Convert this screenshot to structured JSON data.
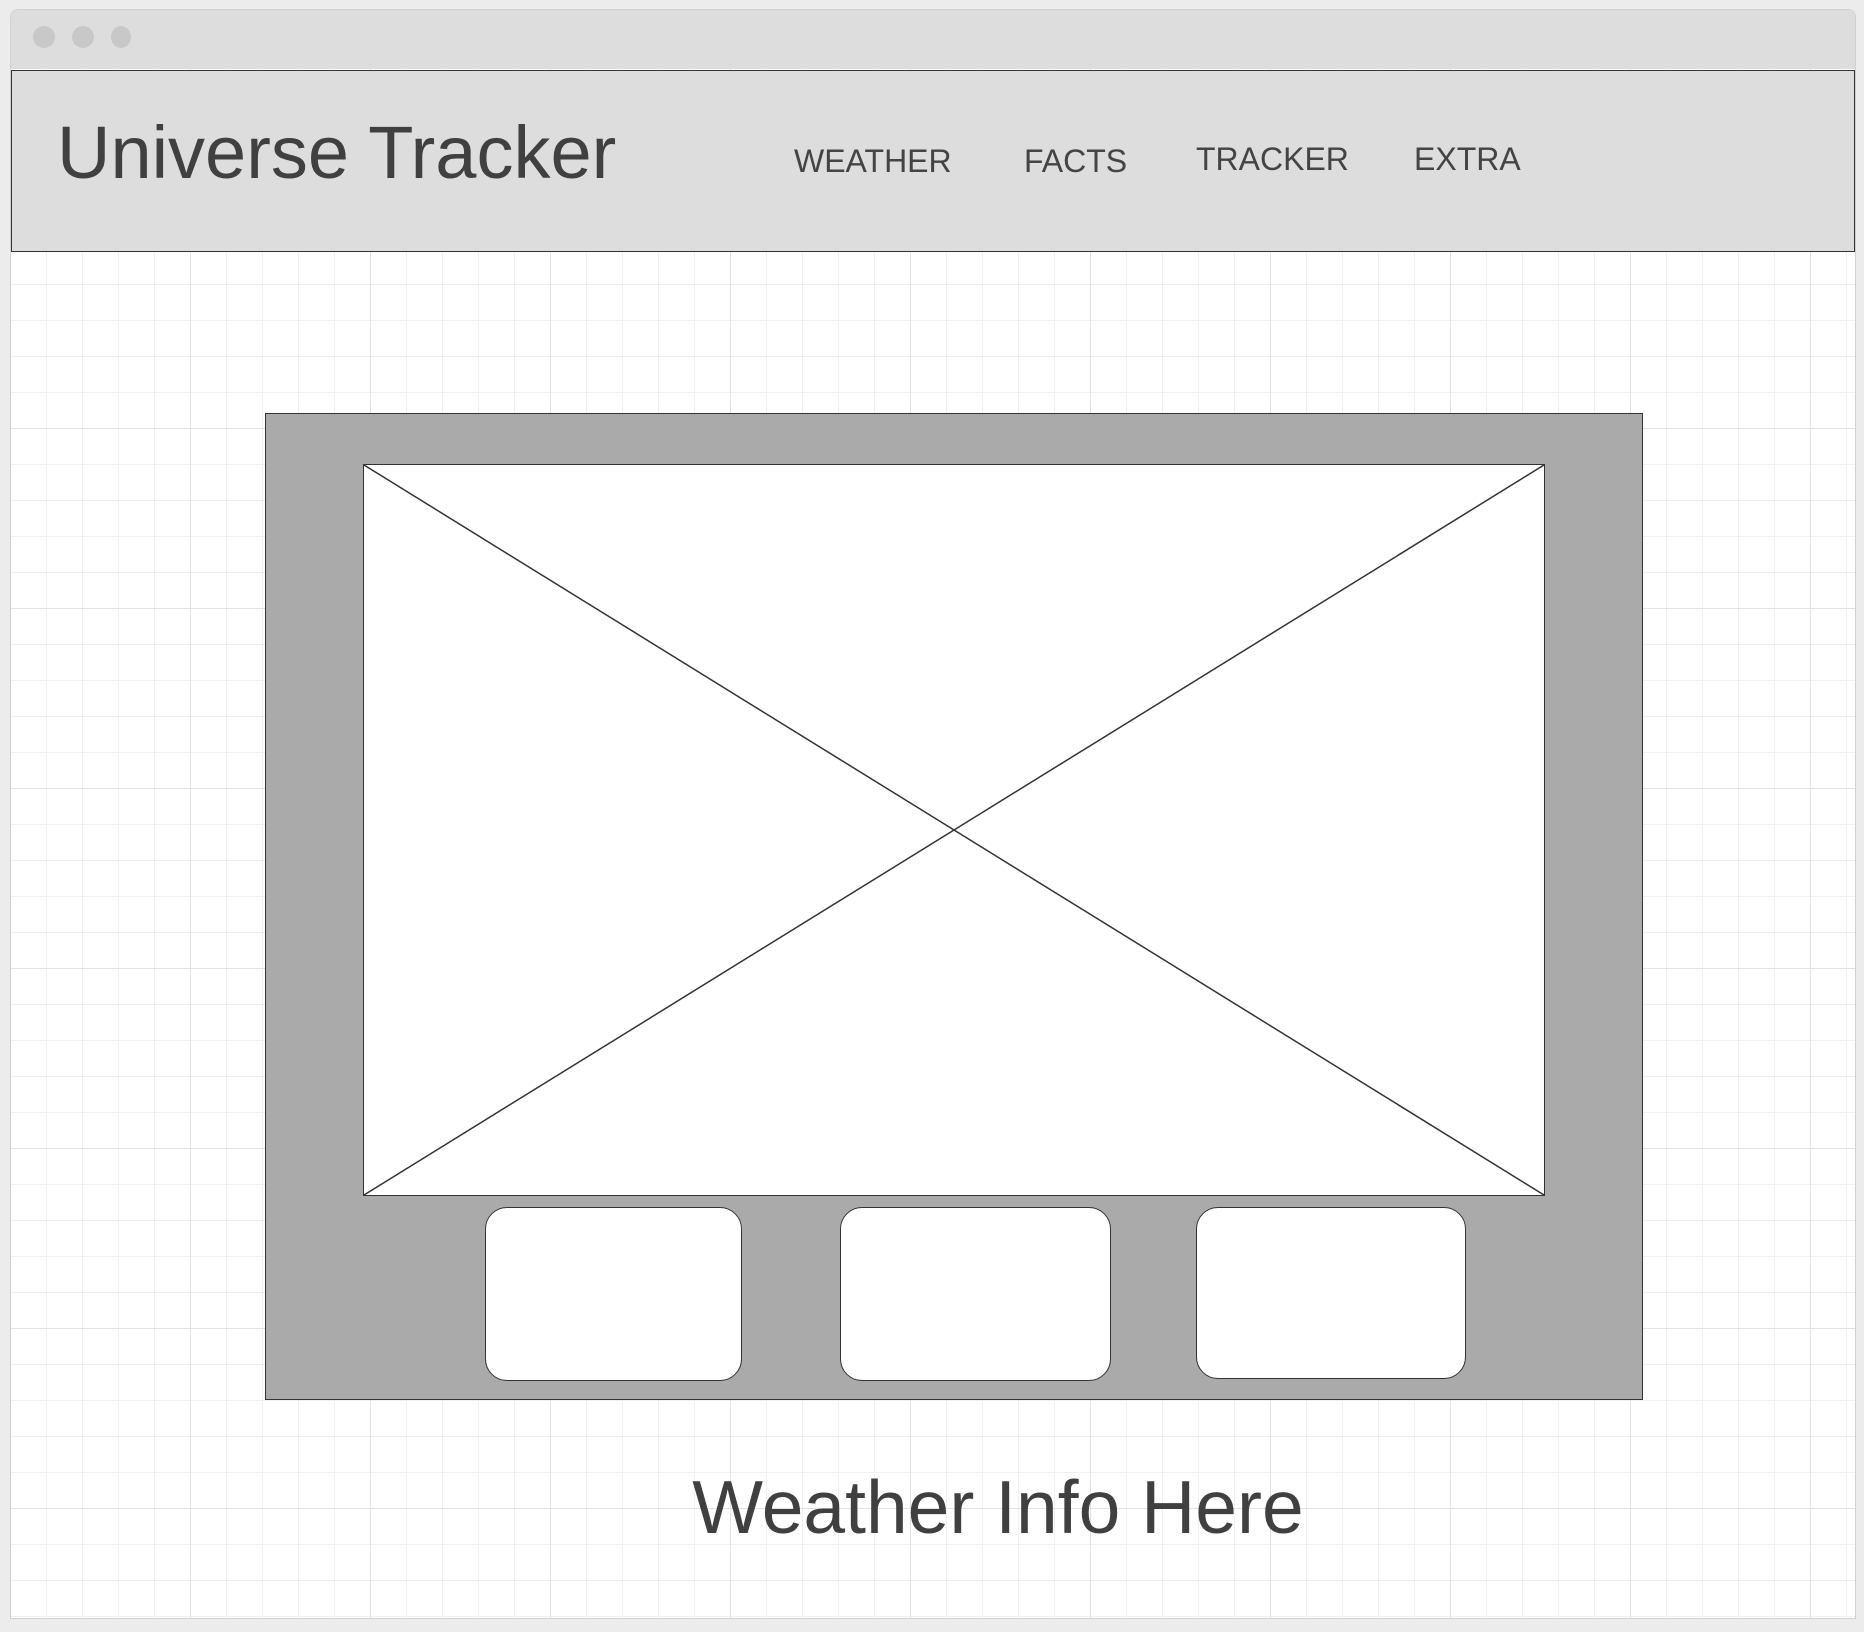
{
  "window": {
    "controls": [
      "close-icon",
      "minimize-icon",
      "maximize-icon"
    ]
  },
  "header": {
    "title": "Universe Tracker",
    "nav": [
      {
        "label": "WEATHER"
      },
      {
        "label": "FACTS"
      },
      {
        "label": "TRACKER"
      },
      {
        "label": "EXTRA"
      }
    ]
  },
  "main": {
    "image_icon": "image-placeholder-icon",
    "caption": "Weather Info Here"
  },
  "colors": {
    "navbar_bg": "#dddddd",
    "panel_bg": "#aaaaaa",
    "text": "#404040",
    "border": "#333333"
  }
}
